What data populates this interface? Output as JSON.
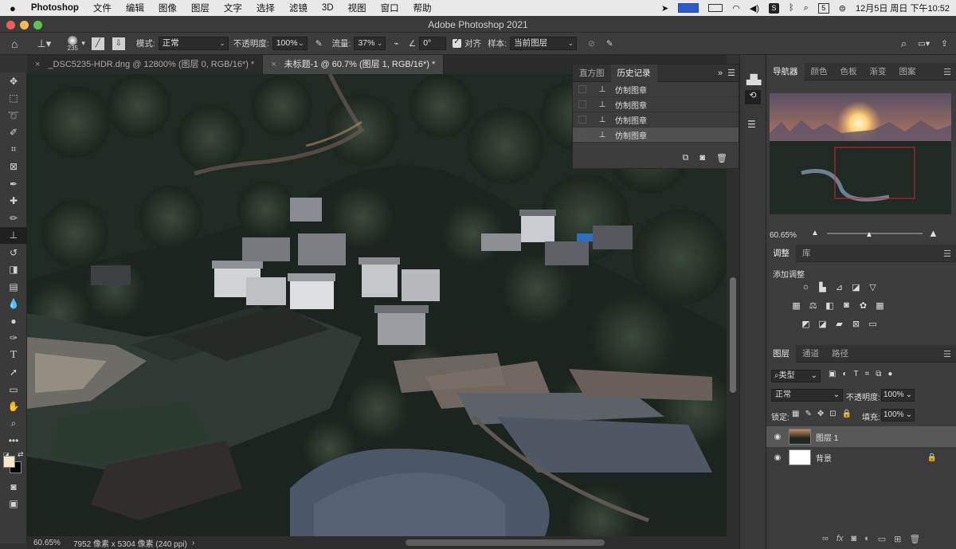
{
  "menubar": {
    "apple": "",
    "items": [
      "Photoshop",
      "文件",
      "编辑",
      "图像",
      "图层",
      "文字",
      "选择",
      "滤镜",
      "3D",
      "视图",
      "窗口",
      "帮助"
    ],
    "datetime": "12月5日 周日 下午10:52",
    "calendar_day": "5"
  },
  "window": {
    "title": "Adobe Photoshop 2021"
  },
  "options": {
    "brush_size": "235",
    "mode_label": "模式:",
    "mode_value": "正常",
    "opacity_label": "不透明度:",
    "opacity_value": "100%",
    "flow_label": "流量:",
    "flow_value": "37%",
    "angle_value": "0°",
    "align_label": "对齐",
    "sample_label": "样本:",
    "sample_value": "当前图层"
  },
  "tabs": [
    {
      "label": "_DSC5235-HDR.dng @ 12800% (图层 0, RGB/16*) *"
    },
    {
      "label": "未标题-1 @ 60.7% (图层 1, RGB/16*) *"
    }
  ],
  "history_panel": {
    "tabs": [
      "直方图",
      "历史记录"
    ],
    "items": [
      "仿制图章",
      "仿制图章",
      "仿制图章",
      "仿制图章"
    ]
  },
  "navigator": {
    "tabs": [
      "导航器",
      "颜色",
      "色板",
      "渐变",
      "图案"
    ],
    "zoom": "60.65%"
  },
  "adjustments": {
    "tabs": [
      "调整",
      "库"
    ],
    "add_label": "添加调整"
  },
  "layers_panel": {
    "tabs": [
      "图层",
      "通道",
      "路径"
    ],
    "filter_kind": "类型",
    "blend_mode": "正常",
    "opacity_label": "不透明度:",
    "opacity_value": "100%",
    "lock_label": "锁定:",
    "fill_label": "填充:",
    "fill_value": "100%",
    "layers": [
      "图层 1",
      "背景"
    ]
  },
  "status": {
    "zoom": "60.65%",
    "dimensions": "7952 像素 x 5304 像素 (240 ppi)"
  }
}
